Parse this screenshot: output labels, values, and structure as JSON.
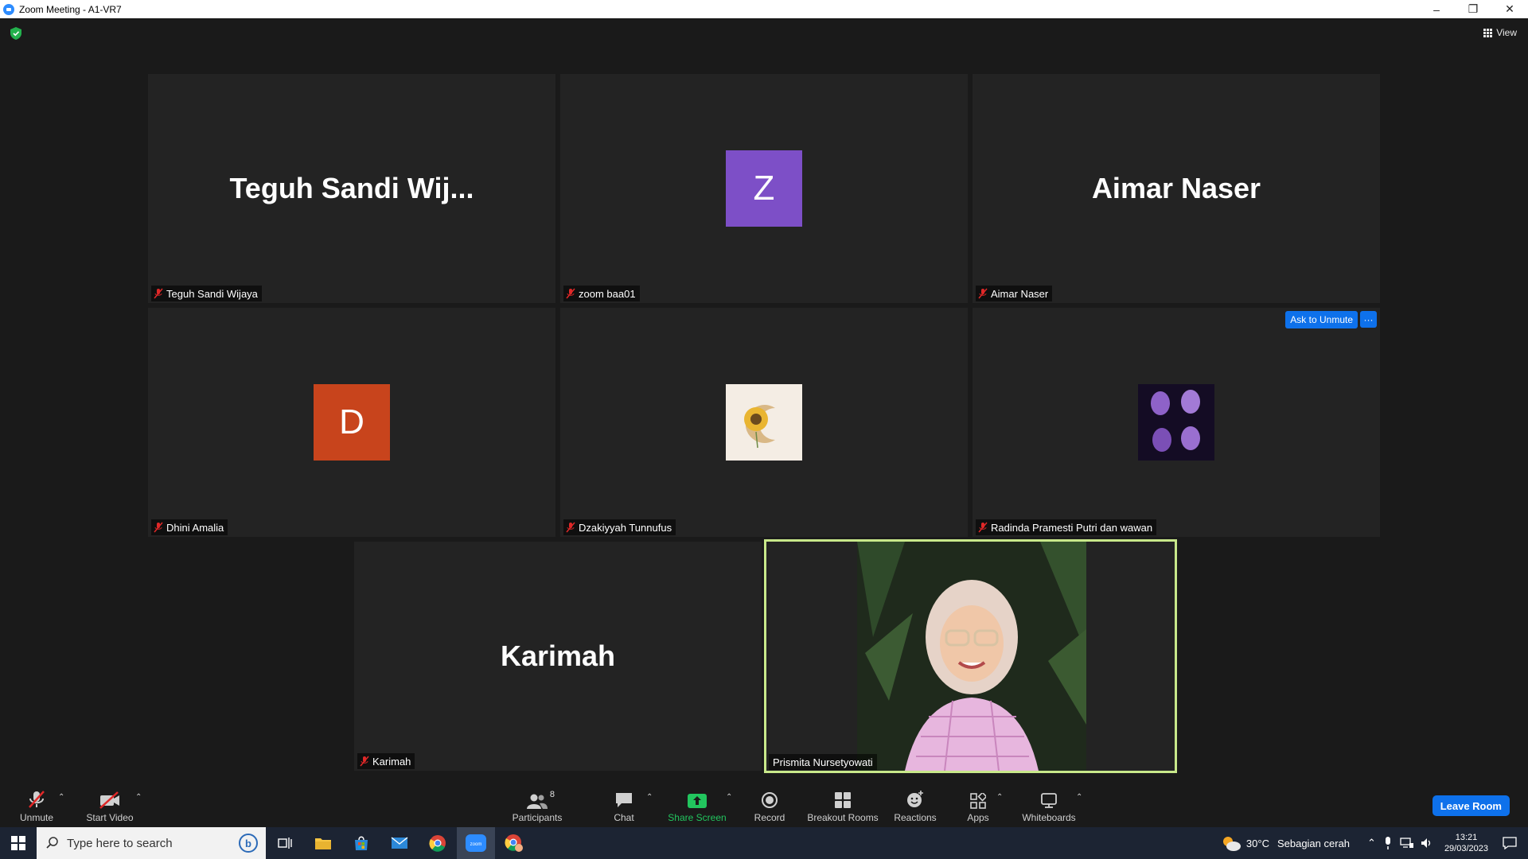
{
  "window": {
    "title": "Zoom Meeting - A1-VR7"
  },
  "top_bar": {
    "view_label": "View"
  },
  "tiles": [
    {
      "display": "Teguh Sandi Wij...",
      "name": "Teguh Sandi Wijaya"
    },
    {
      "avatar_letter": "Z",
      "avatar_color": "#7d4fc7",
      "name": "zoom baa01"
    },
    {
      "display": "Aimar Naser",
      "name": "Aimar Naser"
    },
    {
      "avatar_letter": "D",
      "avatar_color": "#c8441c",
      "name": "Dhini Amalia"
    },
    {
      "name": "Dzakiyyah Tunnufus"
    },
    {
      "name": "Radinda Pramesti Putri dan wawan",
      "ask_unmute": "Ask to Unmute",
      "more": "···"
    },
    {
      "display": "Karimah",
      "name": "Karimah"
    },
    {
      "name": "Prismita Nursetyowati"
    }
  ],
  "toolbar": {
    "unmute": "Unmute",
    "start_video": "Start Video",
    "participants": "Participants",
    "participants_count": "8",
    "chat": "Chat",
    "share_screen": "Share Screen",
    "record": "Record",
    "breakout_rooms": "Breakout Rooms",
    "reactions": "Reactions",
    "apps": "Apps",
    "whiteboards": "Whiteboards",
    "leave": "Leave Room"
  },
  "taskbar": {
    "search_placeholder": "Type here to search",
    "weather_temp": "30°C",
    "weather_desc": "Sebagian cerah",
    "time": "13:21",
    "date": "29/03/2023"
  },
  "colors": {
    "accent": "#0e71eb",
    "active_speaker": "#c8e88a",
    "share_green": "#22c55e"
  }
}
